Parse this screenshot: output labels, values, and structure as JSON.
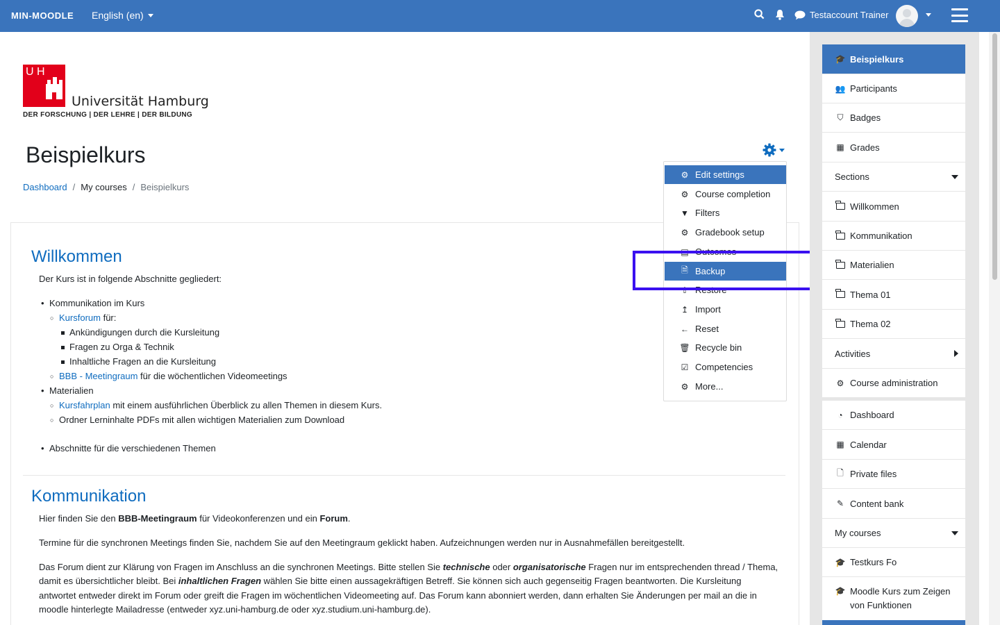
{
  "navbar": {
    "brand": "MIN-MOODLE",
    "language": "English (en)",
    "user_name": "Testaccount Trainer"
  },
  "logo": {
    "mark": "U H",
    "name": "Universität Hamburg",
    "tagline": "DER FORSCHUNG | DER LEHRE | DER BILDUNG"
  },
  "page": {
    "title": "Beispielkurs",
    "breadcrumb": [
      "Dashboard",
      "/",
      "My courses",
      "/",
      "Beispielkurs"
    ]
  },
  "admin_menu": {
    "items": [
      {
        "label": "Edit settings",
        "icon": "gear-icon"
      },
      {
        "label": "Course completion",
        "icon": "gear-icon"
      },
      {
        "label": "Filters",
        "icon": "filter-icon"
      },
      {
        "label": "Gradebook setup",
        "icon": "gear-icon"
      },
      {
        "label": "Outcomes",
        "icon": "outcomes-icon"
      },
      {
        "label": "Backup",
        "icon": "backup-file-icon"
      },
      {
        "label": "Restore",
        "icon": "restore-icon"
      },
      {
        "label": "Import",
        "icon": "import-icon"
      },
      {
        "label": "Reset",
        "icon": "arrow-left-icon"
      },
      {
        "label": "Recycle bin",
        "icon": "trash-icon"
      },
      {
        "label": "Competencies",
        "icon": "checkbox-icon"
      },
      {
        "label": "More...",
        "icon": "gear-icon"
      }
    ]
  },
  "content": {
    "sec1_title": "Willkommen",
    "intro": "Der Kurs ist in folgende Abschnitte gegliedert:",
    "b1": "Kommunikation im Kurs",
    "b1_1_link": "Kursforum",
    "b1_1_rest": " für:",
    "b1_1_a": "Ankündigungen durch die Kursleitung",
    "b1_1_b": "Fragen zu Orga & Technik",
    "b1_1_c": "Inhaltliche Fragen an die Kursleitung",
    "b1_2_link": "BBB - Meetingraum",
    "b1_2_rest": " für die wöchentlichen Videomeetings",
    "b2": "Materialien",
    "b2_1_link": "Kursfahrplan",
    "b2_1_rest": " mit einem ausführlichen Überblick zu allen Themen in diesem Kurs.",
    "b2_2": "Ordner Lerninhalte PDFs mit allen wichtigen Materialien zum Download",
    "b3": "Abschnitte für die verschiedenen Themen",
    "sec2_title": "Kommunikation",
    "p1_a": "Hier finden Sie den ",
    "p1_b": "BBB-Meetingraum",
    "p1_c": " für Videokonferenzen und ein ",
    "p1_d": "Forum",
    "p1_e": ".",
    "p2": "Termine für die synchronen Meetings finden Sie, nachdem Sie auf den Meetingraum geklickt haben. Aufzeichnungen werden nur in Ausnahmefällen bereitgestellt.",
    "p3_l1_a": "Das Forum dient zur Klärung von Fragen im Anschluss an die synchronen Meetings. Bitte stellen Sie ",
    "p3_l1_b": "technische",
    "p3_l1_c": " oder ",
    "p3_l1_d": "organisatorische",
    "p3_l1_e": " Fragen nur im entsprechenden thread / Thema,",
    "p3_l2_a": "damit es übersichtlicher bleibt. Bei ",
    "p3_l2_b": "inhaltlichen Fragen",
    "p3_l2_c": " wählen Sie bitte einen aussagekräftigen Betreff. Sie können sich auch gegenseitig Fragen beantworten. Die Kursleitung",
    "p3_l3": "antwortet entweder direkt im Forum oder greift die Fragen im wöchentlichen Videomeeting auf. Das Forum kann abonniert werden, dann erhalten Sie Änderungen per mail an die in",
    "p3_l4": "moodle hinterlegte Mailadresse (entweder xyz.uni-hamburg.de oder xyz.studium.uni-hamburg.de)."
  },
  "sidebar": {
    "items": [
      {
        "label": "Beispielkurs",
        "icon": "graduation-cap-icon"
      },
      {
        "label": "Participants",
        "icon": "users-icon"
      },
      {
        "label": "Badges",
        "icon": "shield-icon"
      },
      {
        "label": "Grades",
        "icon": "table-icon"
      },
      {
        "label": "Sections"
      },
      {
        "label": "Willkommen",
        "icon": "folder-icon"
      },
      {
        "label": "Kommunikation",
        "icon": "folder-icon"
      },
      {
        "label": "Materialien",
        "icon": "folder-icon"
      },
      {
        "label": "Thema 01",
        "icon": "folder-icon"
      },
      {
        "label": "Thema 02",
        "icon": "folder-icon"
      },
      {
        "label": "Activities"
      },
      {
        "label": "Course administration",
        "icon": "gear-icon"
      },
      {
        "label": "Dashboard",
        "icon": "dashboard-icon"
      },
      {
        "label": "Calendar",
        "icon": "calendar-icon"
      },
      {
        "label": "Private files",
        "icon": "file-icon"
      },
      {
        "label": "Content bank",
        "icon": "brush-icon"
      },
      {
        "label": "My courses"
      },
      {
        "label": "Testkurs Fo",
        "icon": "graduation-cap-icon"
      },
      {
        "label": "Moodle Kurs zum Zeigen",
        "label2": "von Funktionen",
        "icon": "graduation-cap-icon"
      }
    ]
  },
  "colors": {
    "navbar": "#3a74bc",
    "link": "#0f6cbf",
    "highlight_box": "#3a10f0"
  }
}
